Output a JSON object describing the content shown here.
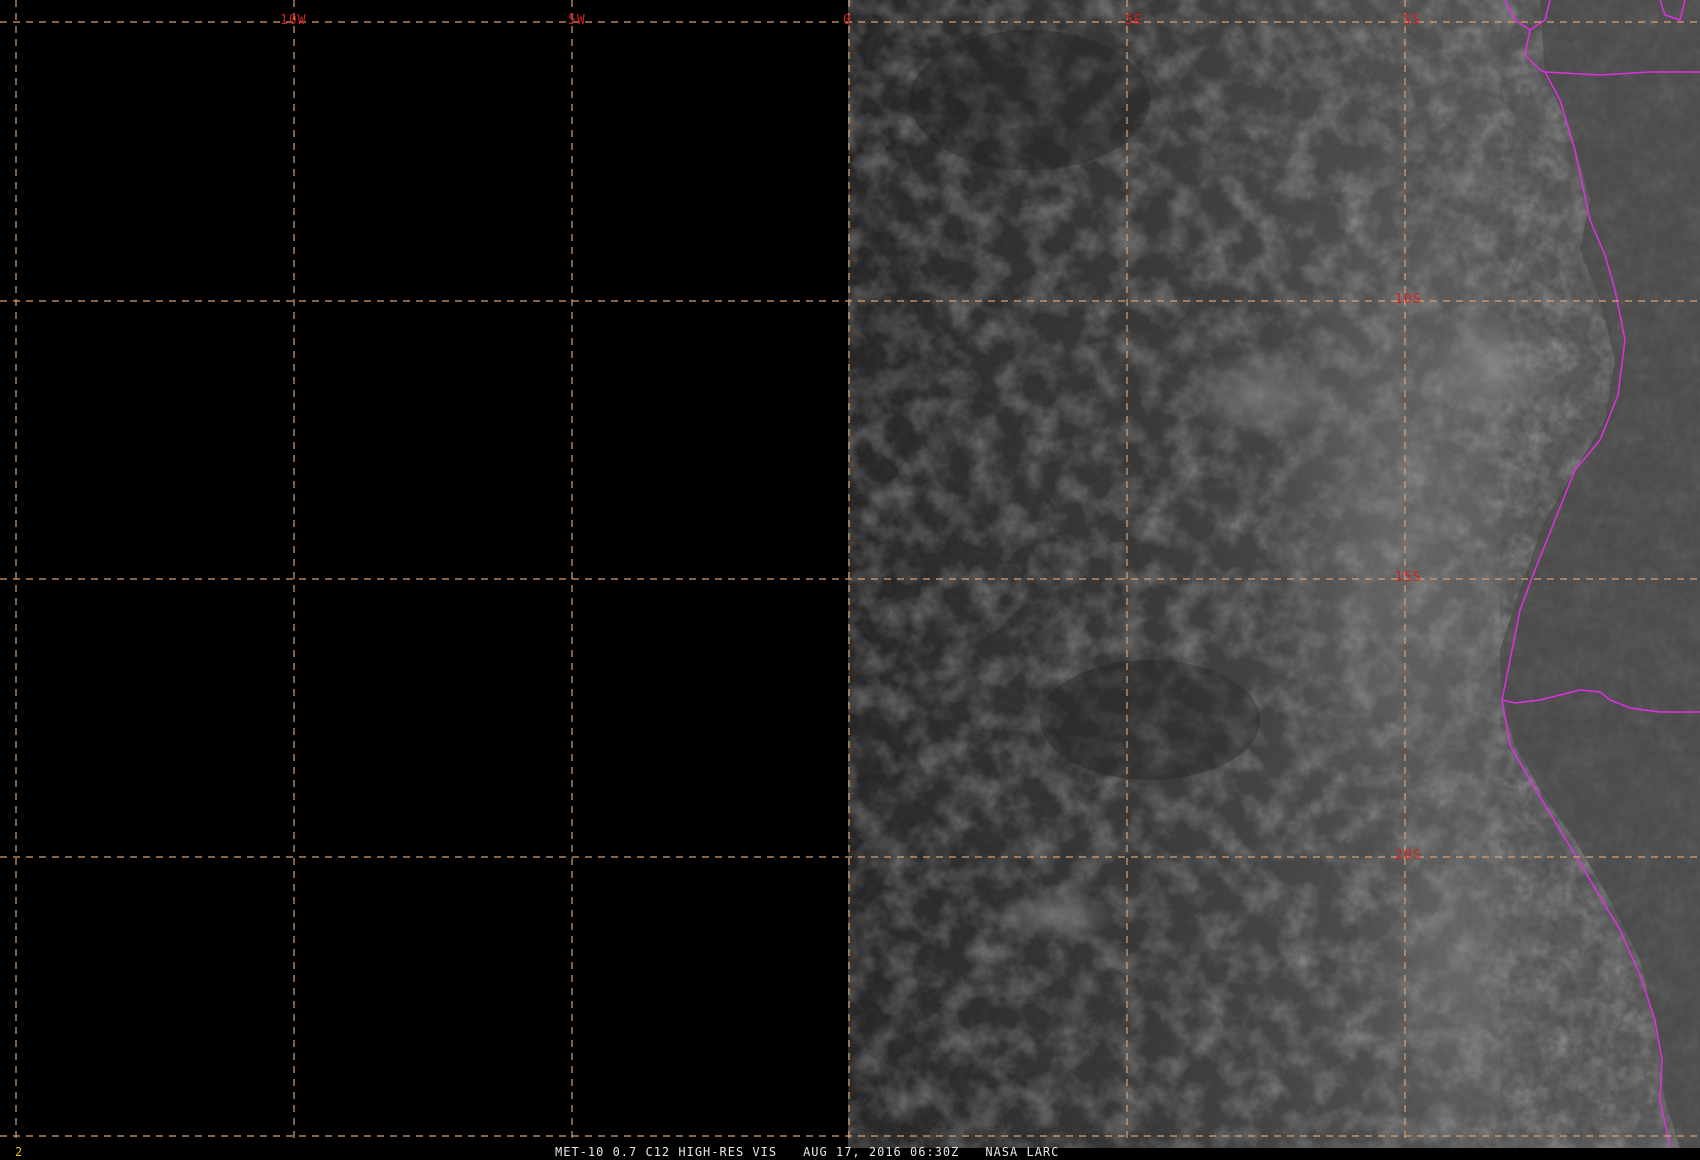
{
  "map": {
    "frame_number": "2",
    "longitude_labels": [
      "10W",
      "5W",
      "0",
      "5E",
      "10E"
    ],
    "latitude_labels": [
      "5S",
      "10S",
      "15S",
      "20S"
    ],
    "footer": {
      "product": "MET-10 0.7 C12 HIGH-RES VIS",
      "datetime": "AUG 17, 2016 06:30Z",
      "credit": "NASA LARC"
    },
    "colors": {
      "background": "#000000",
      "graticule": "#d9a070",
      "grid_labels": "#d02020",
      "political_boundaries": "#e030e0",
      "frame_number": "#e6c400",
      "footer_text": "#e8e8e8"
    }
  }
}
